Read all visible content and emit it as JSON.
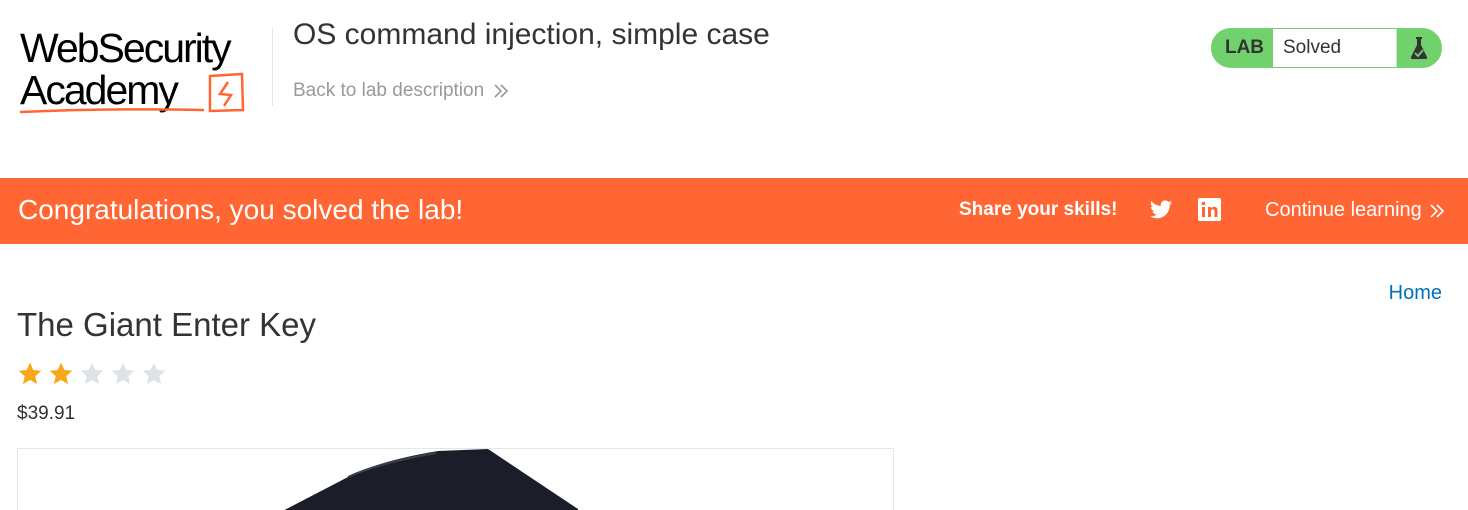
{
  "header": {
    "logo_line1": "WebSecurity",
    "logo_line2": "Academy",
    "lab_title": "OS command injection, simple case",
    "back_link": "Back to lab description",
    "lab_badge": "LAB",
    "lab_status": "Solved"
  },
  "banner": {
    "message": "Congratulations, you solved the lab!",
    "share_label": "Share your skills!",
    "continue_label": "Continue learning",
    "background_color": "#ff6633"
  },
  "nav": {
    "home": "Home"
  },
  "product": {
    "name": "The Giant Enter Key",
    "rating": 2,
    "rating_max": 5,
    "price": "$39.91"
  },
  "colors": {
    "accent": "#ff6633",
    "solved_green": "#70d16d",
    "link_blue": "#0071bc",
    "star_filled": "#f9a71a",
    "star_empty": "#dde3e6"
  },
  "icons": {
    "back": "double-chevron-right-icon",
    "status": "flask-icon",
    "twitter": "twitter-icon",
    "linkedin": "linkedin-icon",
    "continue": "double-chevron-right-icon",
    "star": "star-icon"
  }
}
